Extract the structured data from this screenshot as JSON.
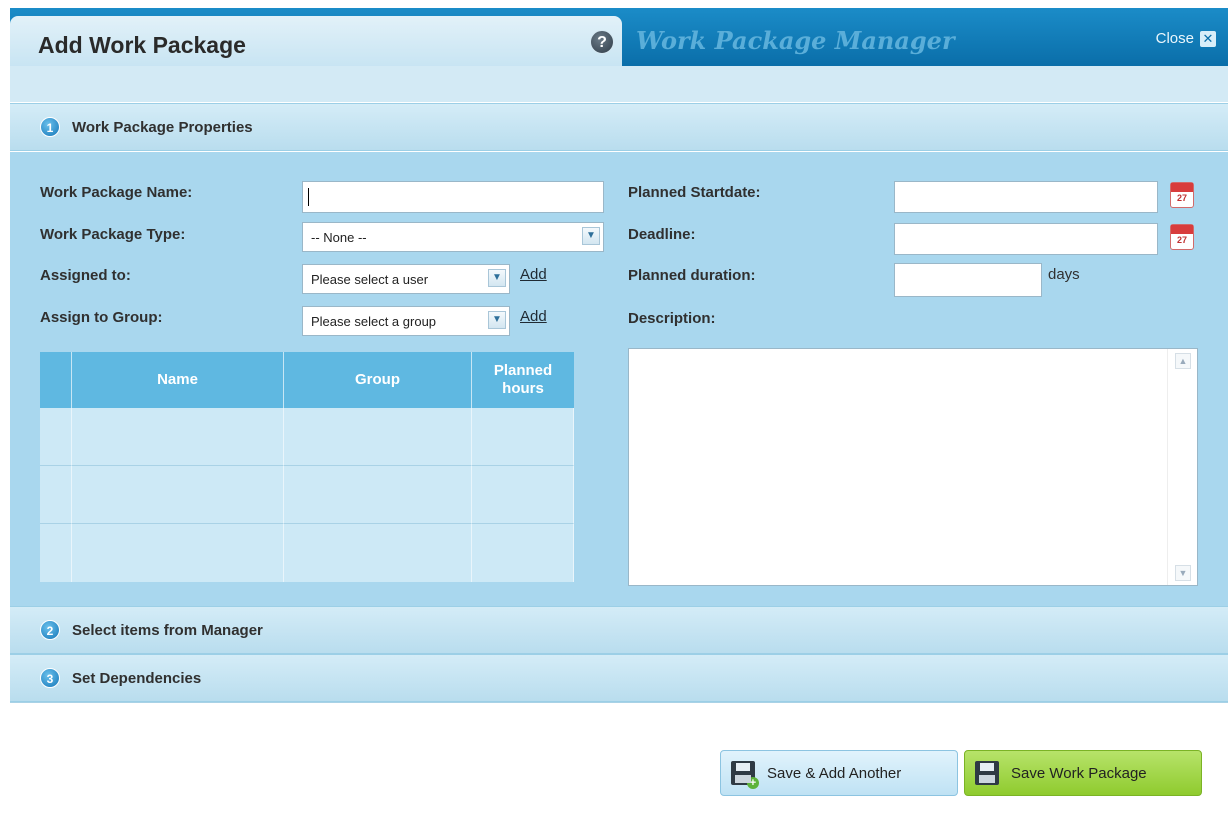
{
  "dialog": {
    "title": "Add Work Package",
    "help_icon": "question-icon",
    "manager_title": "Work Package Manager",
    "close_label": "Close"
  },
  "sections": [
    {
      "number": "1",
      "label": "Work Package Properties",
      "expanded": true
    },
    {
      "number": "2",
      "label": "Select items from Manager",
      "expanded": false
    },
    {
      "number": "3",
      "label": "Set Dependencies",
      "expanded": false
    }
  ],
  "form": {
    "name": {
      "label": "Work Package Name:",
      "value": ""
    },
    "type": {
      "label": "Work Package Type:",
      "selected": "-- None --"
    },
    "assigned": {
      "label": "Assigned to:",
      "selected": "Please select a user",
      "add_label": "Add"
    },
    "group": {
      "label": "Assign to Group:",
      "selected": "Please select a group",
      "add_label": "Add"
    },
    "startdate": {
      "label": "Planned Startdate:",
      "value": "",
      "calendar_day": "27"
    },
    "deadline": {
      "label": "Deadline:",
      "value": "",
      "calendar_day": "27"
    },
    "duration": {
      "label": "Planned duration:",
      "value": "",
      "unit": "days"
    },
    "description": {
      "label": "Description:",
      "value": ""
    }
  },
  "assignees_table": {
    "columns": [
      "Name",
      "Group",
      "Planned hours"
    ],
    "rows": [
      [
        "",
        "",
        ""
      ],
      [
        "",
        "",
        ""
      ],
      [
        "",
        "",
        ""
      ]
    ]
  },
  "buttons": {
    "save_add_another": "Save & Add Another",
    "save": "Save Work Package"
  },
  "colors": {
    "header_blue": "#0a6ea9",
    "panel_blue": "#a9d7ee",
    "table_header": "#5fb8e1",
    "primary_button": "#8fcb2e"
  }
}
